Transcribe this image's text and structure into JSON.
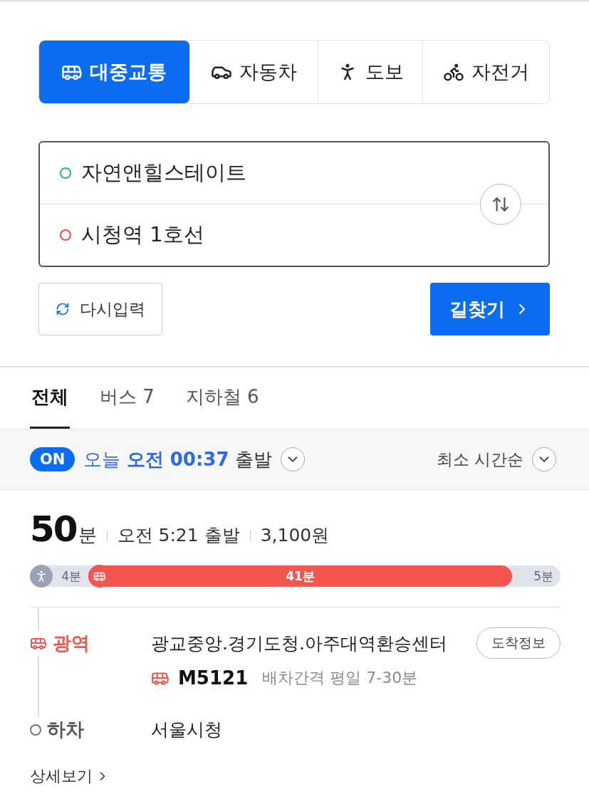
{
  "modes": [
    {
      "kind": "bus",
      "label": "대중교통",
      "selected": true
    },
    {
      "kind": "car",
      "label": "자동차",
      "selected": false
    },
    {
      "kind": "walk",
      "label": "도보",
      "selected": false
    },
    {
      "kind": "bike",
      "label": "자전거",
      "selected": false
    }
  ],
  "route_inputs": [
    {
      "value": "자연앤힐스테이트",
      "color": "#2eb67d"
    },
    {
      "value": "시청역 1호선",
      "color": "#f0504a"
    }
  ],
  "reset_button": "다시입력",
  "search_button": "길찾기",
  "result_tabs": [
    {
      "label": "전체",
      "selected": true
    },
    {
      "label": "버스 7",
      "selected": false
    },
    {
      "label": "지하철 6",
      "selected": false
    }
  ],
  "filter": {
    "toggle": "ON",
    "toggle_on": true,
    "day": "오늘",
    "time": "오전 00:37",
    "suffix": "출발",
    "sort": "최소 시간순"
  },
  "result": {
    "duration": "50",
    "unit": "분",
    "departure": "오전 5:21 출발",
    "fare": "3,100원",
    "segments": [
      {
        "kind": "walk",
        "label": "4분"
      },
      {
        "kind": "bus",
        "label": "41분"
      },
      {
        "kind": "walk",
        "label": "5분"
      }
    ],
    "steps": [
      {
        "kind": "board",
        "label": "광역",
        "stop": "광교중앙.경기도청.아주대역환승센터",
        "button": "도착정보",
        "bus": "M5121",
        "interval": "배차간격 평일 7-30분"
      },
      {
        "kind": "alight",
        "label": "하차",
        "stop": "서울시청"
      }
    ],
    "details_link": "상세보기"
  }
}
